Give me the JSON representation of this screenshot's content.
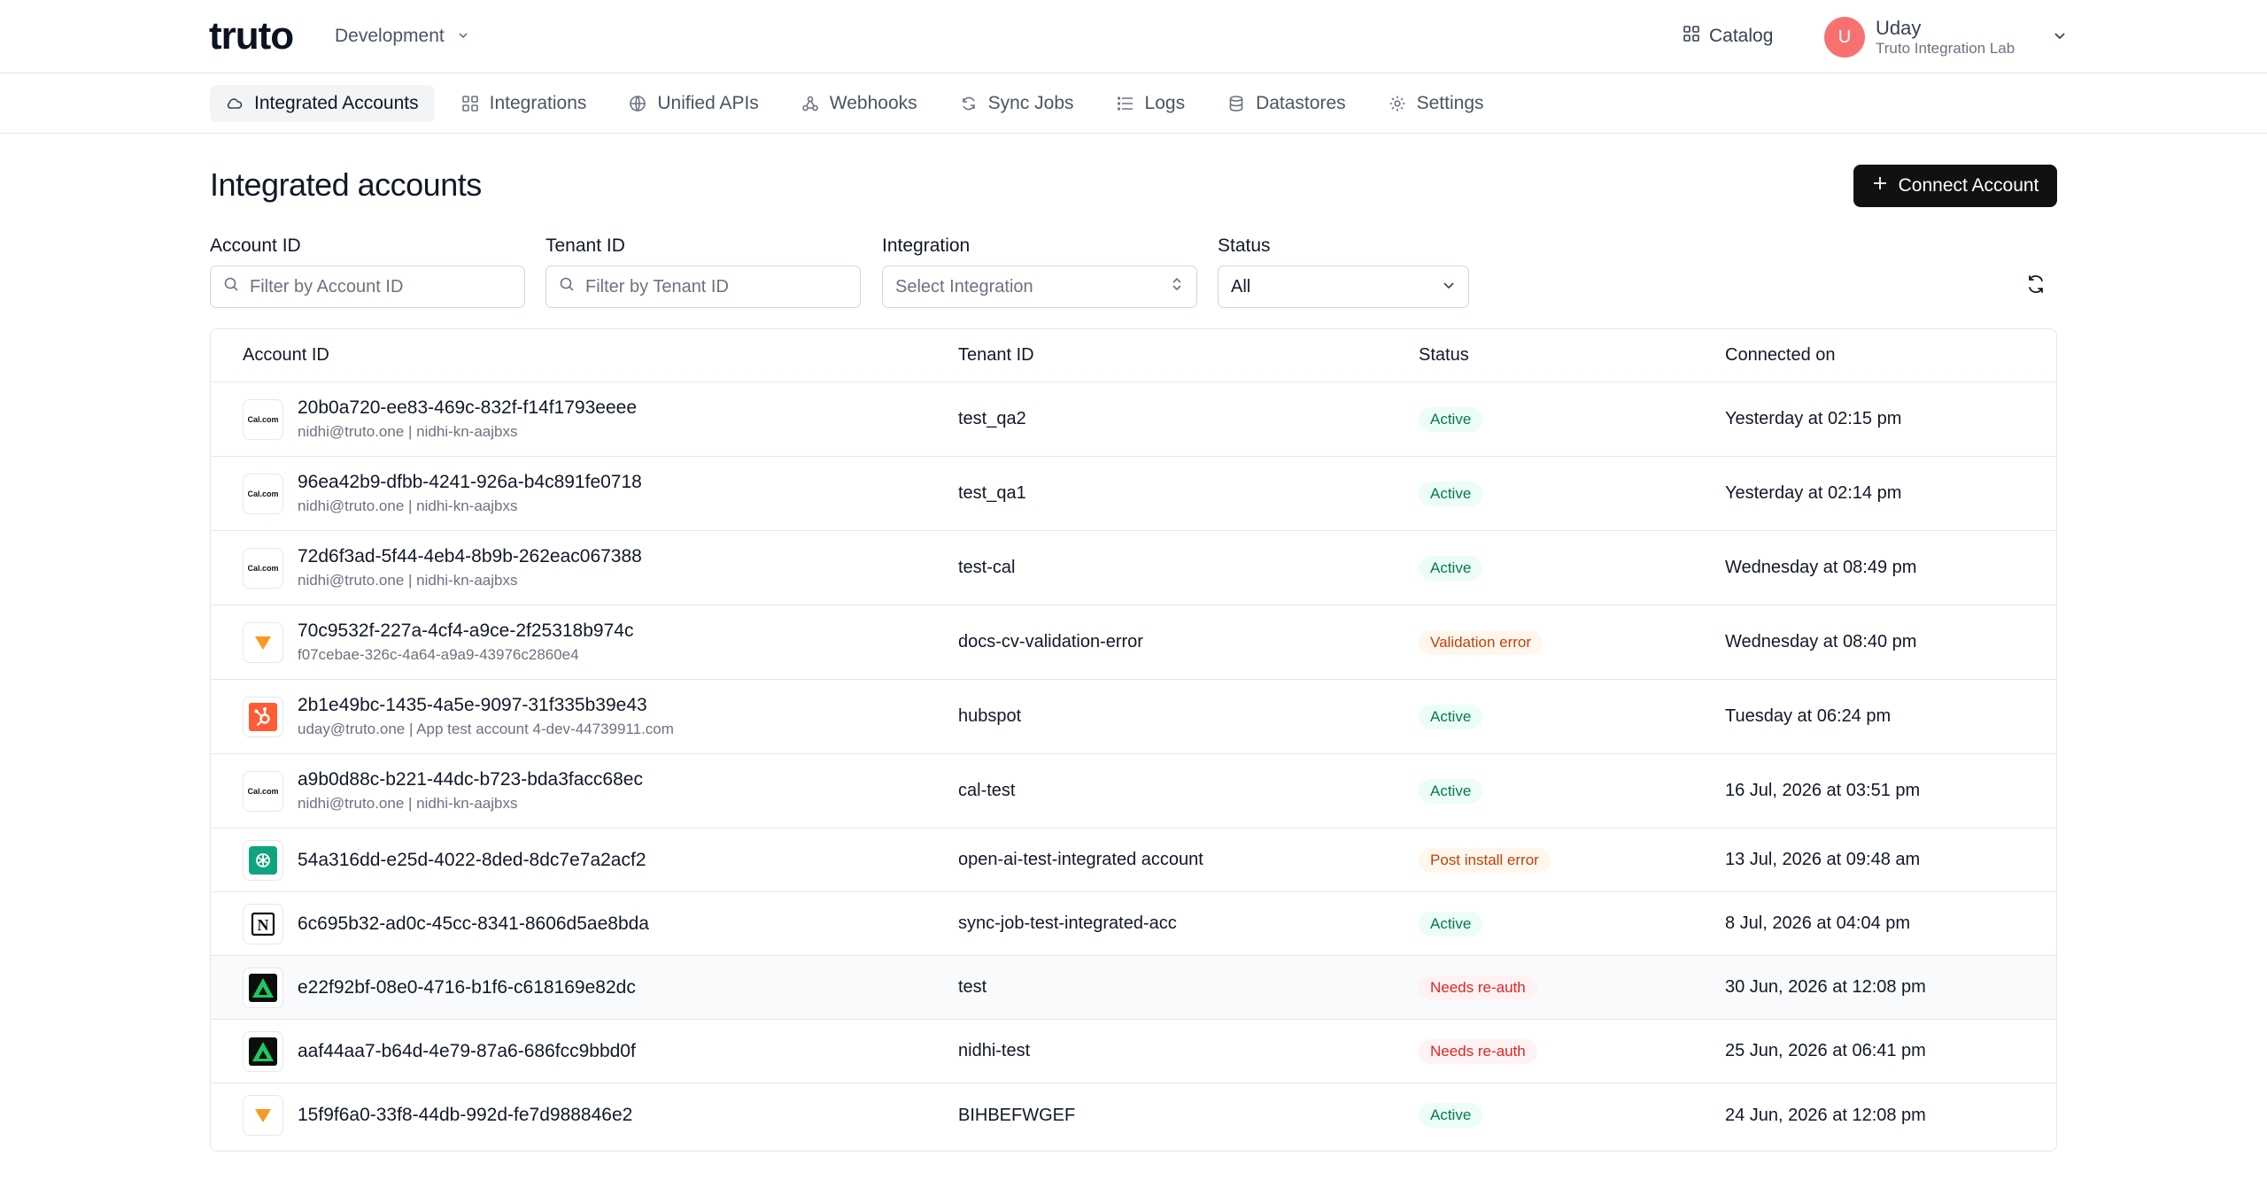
{
  "header": {
    "logo_text": "truto",
    "environment": "Development",
    "catalog_label": "Catalog",
    "user_initial": "U",
    "user_name": "Uday",
    "user_org": "Truto Integration Lab",
    "avatar_color": "#f87171"
  },
  "nav": [
    {
      "label": "Integrated Accounts",
      "icon": "cloud-icon",
      "active": true
    },
    {
      "label": "Integrations",
      "icon": "grid-icon"
    },
    {
      "label": "Unified APIs",
      "icon": "globe-icon"
    },
    {
      "label": "Webhooks",
      "icon": "webhook-icon"
    },
    {
      "label": "Sync Jobs",
      "icon": "sync-icon"
    },
    {
      "label": "Logs",
      "icon": "list-icon"
    },
    {
      "label": "Datastores",
      "icon": "database-icon"
    },
    {
      "label": "Settings",
      "icon": "gear-icon"
    }
  ],
  "page": {
    "title": "Integrated accounts",
    "connect_button": "Connect Account"
  },
  "filters": {
    "account_id_label": "Account ID",
    "account_id_placeholder": "Filter by Account ID",
    "tenant_id_label": "Tenant ID",
    "tenant_id_placeholder": "Filter by Tenant ID",
    "integration_label": "Integration",
    "integration_value": "Select Integration",
    "status_label": "Status",
    "status_value": "All"
  },
  "table": {
    "columns": [
      "Account ID",
      "Tenant ID",
      "Status",
      "Connected on"
    ],
    "rows": [
      {
        "icon": "calcom-icon",
        "account_id": "20b0a720-ee83-469c-832f-f14f1793eeee",
        "sub": "nidhi@truto.one | nidhi-kn-aajbxs",
        "tenant": "test_qa2",
        "status": "Active",
        "status_kind": "active",
        "connected": "Yesterday at 02:15 pm"
      },
      {
        "icon": "calcom-icon",
        "account_id": "96ea42b9-dfbb-4241-926a-b4c891fe0718",
        "sub": "nidhi@truto.one | nidhi-kn-aajbxs",
        "tenant": "test_qa1",
        "status": "Active",
        "status_kind": "active",
        "connected": "Yesterday at 02:14 pm"
      },
      {
        "icon": "calcom-icon",
        "account_id": "72d6f3ad-5f44-4eb4-8b9b-262eac067388",
        "sub": "nidhi@truto.one | nidhi-kn-aajbxs",
        "tenant": "test-cal",
        "status": "Active",
        "status_kind": "active",
        "connected": "Wednesday at 08:49 pm"
      },
      {
        "icon": "triangle-orange-icon",
        "account_id": "70c9532f-227a-4cf4-a9ce-2f25318b974c",
        "sub": "f07cebae-326c-4a64-a9a9-43976c2860e4",
        "tenant": "docs-cv-validation-error",
        "status": "Validation error",
        "status_kind": "warn",
        "connected": "Wednesday at 08:40 pm"
      },
      {
        "icon": "hubspot-icon",
        "account_id": "2b1e49bc-1435-4a5e-9097-31f335b39e43",
        "sub": "uday@truto.one | App test account 4-dev-44739911.com",
        "tenant": "hubspot",
        "status": "Active",
        "status_kind": "active",
        "connected": "Tuesday at 06:24 pm"
      },
      {
        "icon": "calcom-icon",
        "account_id": "a9b0d88c-b221-44dc-b723-bda3facc68ec",
        "sub": "nidhi@truto.one | nidhi-kn-aajbxs",
        "tenant": "cal-test",
        "status": "Active",
        "status_kind": "active",
        "connected": "16 Jul, 2026 at 03:51 pm"
      },
      {
        "icon": "openai-icon",
        "account_id": "54a316dd-e25d-4022-8ded-8dc7e7a2acf2",
        "sub": "",
        "tenant": "open-ai-test-integrated account",
        "status": "Post install error",
        "status_kind": "warn",
        "connected": "13 Jul, 2026 at 09:48 am"
      },
      {
        "icon": "notion-icon",
        "account_id": "6c695b32-ad0c-45cc-8341-8606d5ae8bda",
        "sub": "",
        "tenant": "sync-job-test-integrated-acc",
        "status": "Active",
        "status_kind": "active",
        "connected": "8 Jul, 2026 at 04:04 pm"
      },
      {
        "icon": "green-triangle-icon",
        "account_id": "e22f92bf-08e0-4716-b1f6-c618169e82dc",
        "sub": "",
        "tenant": "test",
        "status": "Needs re-auth",
        "status_kind": "err",
        "connected": "30 Jun, 2026 at 12:08 pm"
      },
      {
        "icon": "green-triangle-icon",
        "account_id": "aaf44aa7-b64d-4e79-87a6-686fcc9bbd0f",
        "sub": "",
        "tenant": "nidhi-test",
        "status": "Needs re-auth",
        "status_kind": "err",
        "connected": "25 Jun, 2026 at 06:41 pm"
      },
      {
        "icon": "triangle-orange-icon",
        "account_id": "15f9f6a0-33f8-44db-992d-fe7d988846e2",
        "sub": "",
        "tenant": "BIHBEFWGEF",
        "status": "Active",
        "status_kind": "active",
        "connected": "24 Jun, 2026 at 12:08 pm"
      }
    ]
  }
}
